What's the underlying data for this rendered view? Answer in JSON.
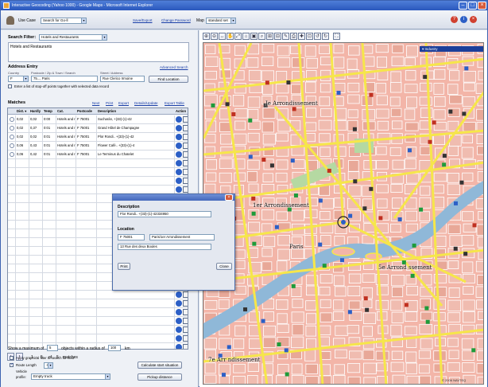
{
  "window": {
    "title": "Interactive Geocoding (Yahoo 1000) - Google Maps - Microsoft Internet Explorer",
    "controls": [
      "minimize-icon",
      "maximize-icon",
      "close-icon"
    ]
  },
  "toolbar": {
    "use_case_label": "Use Case",
    "use_case_value": "Search for Go-ll",
    "links": [
      "Save/Export",
      "Change Password"
    ],
    "map_label": "Map",
    "map_value": "standard set",
    "right_icons": [
      "help-icon",
      "info-icon",
      "exit-icon"
    ]
  },
  "search_filter": {
    "label": "Search Filter:",
    "value": "Hotels and Restaurants",
    "selected_item": "Hotels and Restaurants"
  },
  "address_entry": {
    "title": "Address Entry",
    "advanced_link": "Advanced Search",
    "country_label": "Country",
    "postal_label": "Postcode / Zip & Town / Search",
    "street_label": "Street / Address",
    "country_value": "F",
    "postal_value": "75..., Paris",
    "street_value": "Rue Clerico Irmoine",
    "find_button": "Find Location",
    "multi_label": "Enter a list of stop-off points together with selected data record"
  },
  "matches": {
    "title": "Matches",
    "actions": [
      "Next",
      "Print",
      "Export",
      "Details/Update",
      "Export Table"
    ],
    "columns": [
      "",
      "Dist. ▾",
      "Hardly",
      "Temp",
      "Cat.",
      "Postcode",
      "Description",
      "Action"
    ],
    "rows": [
      {
        "dist": "0,02",
        "b": "0,02",
        "c": "0:00",
        "cat": "Hotels and r",
        "postcode": "F 75001",
        "desc": "Sucharán, +(33)-(1)-42"
      },
      {
        "dist": "0,02",
        "b": "0,37",
        "c": "0:01",
        "cat": "Hotels and r",
        "postcode": "F 75001",
        "desc": "Grand Hôtel de Champagne"
      },
      {
        "dist": "0,02",
        "b": "0,02",
        "c": "0:01",
        "cat": "Hotels and r",
        "postcode": "F 75001",
        "desc": "Plor Rondi.. +(33)-(1)-42"
      },
      {
        "dist": "0,06",
        "b": "0,43",
        "c": "0:01",
        "cat": "Hotels and r",
        "postcode": "F 75001",
        "desc": "Flower Café.. +(33)-(1)-4"
      },
      {
        "dist": "0,06",
        "b": "0,42",
        "c": "0:01",
        "cat": "Hotels and r",
        "postcode": "F 75001",
        "desc": "Le Terminus du Chatelet"
      }
    ],
    "pager": {
      "from": "1",
      "dash": "-",
      "to": "5",
      "of": "of",
      "total": "5",
      "suffix": "matches"
    }
  },
  "bottom_options": {
    "show_max_prefix": "Show a maximum of",
    "max_value": "5",
    "within_label": "objects within a radius of",
    "radius_value": "100",
    "unit": "km",
    "apply_filter_label": "Apply graphical filter to search for next",
    "route_length_label": "Route Length",
    "route_length_value": "+",
    "vehicle_label": "Vehicle",
    "profile_label": "profile:",
    "profile_value": "Empty truck",
    "calc_button": "Calculate start situation",
    "pickup_button": "Pickup distance",
    "apply_filter_checked": false,
    "route_length_checked": true
  },
  "map": {
    "overlay_label": "Industry",
    "labels": [
      {
        "text": "Je Arrondissement",
        "name": "map-label-north"
      },
      {
        "text": "1er Arrondissement",
        "name": "map-label-center"
      },
      {
        "text": "Paris",
        "name": "map-label-paris"
      },
      {
        "text": "5e Arrond ssement",
        "name": "map-label-east"
      },
      {
        "text": "7e Arr ndissement",
        "name": "map-label-southwest"
      }
    ],
    "copyright": "© 2006 NAVTEQ"
  },
  "dialog": {
    "description_label": "Description",
    "description_value": "Flor Rondi.. +(33)-(1)-42334950",
    "location_label": "Location",
    "postcode_value": "F 75001",
    "city_value": "Paris/1er Arrondissement",
    "street_value": "13 Rue des deux Boules",
    "print_button": "Print",
    "close_button": "Close"
  },
  "colors": {
    "titlebar": "#2a58bd",
    "map_block": "#f3b5a8",
    "map_road": "#f6e64a",
    "map_river": "#8fb8d8",
    "map_park": "#b5d9a2"
  }
}
